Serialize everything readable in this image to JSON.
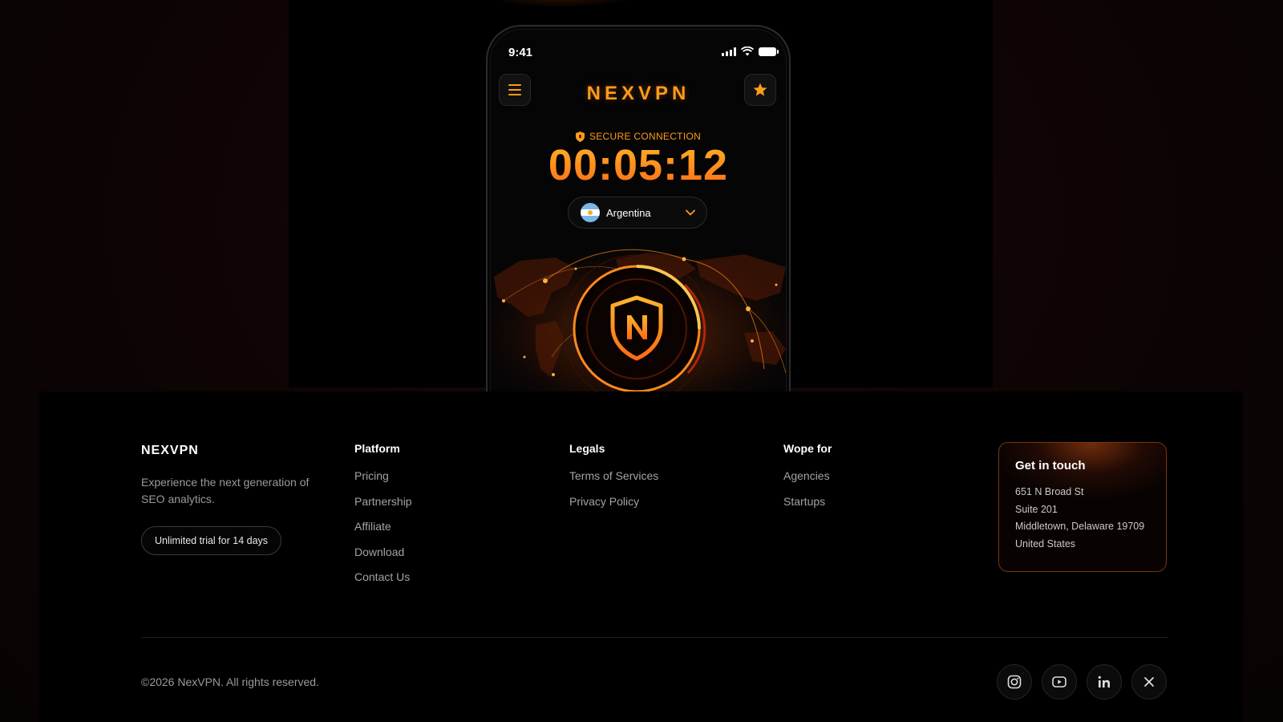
{
  "phone": {
    "status_time": "9:41",
    "brand": "NEXVPN",
    "secure_label": "SECURE CONNECTION",
    "timer": "00:05:12",
    "country": "Argentina",
    "accent_color": "#ff9b1a"
  },
  "footer": {
    "logo": "NEXVPN",
    "tagline": "Experience the next generation of SEO analytics.",
    "trial_button": "Unlimited trial for 14 days",
    "columns": [
      {
        "title": "Platform",
        "links": [
          "Pricing",
          "Partnership",
          "Affiliate",
          "Download",
          "Contact Us"
        ]
      },
      {
        "title": "Legals",
        "links": [
          "Terms of Services",
          "Privacy Policy"
        ]
      },
      {
        "title": "Wope for",
        "links": [
          "Agencies",
          "Startups"
        ]
      }
    ],
    "contact": {
      "title": "Get in touch",
      "lines": [
        "651 N Broad St",
        "Suite 201",
        "Middletown, Delaware 19709",
        "United States"
      ]
    },
    "copyright": "©2026 NexVPN. All rights reserved.",
    "socials": [
      "instagram-icon",
      "youtube-icon",
      "linkedin-icon",
      "x-icon"
    ]
  }
}
